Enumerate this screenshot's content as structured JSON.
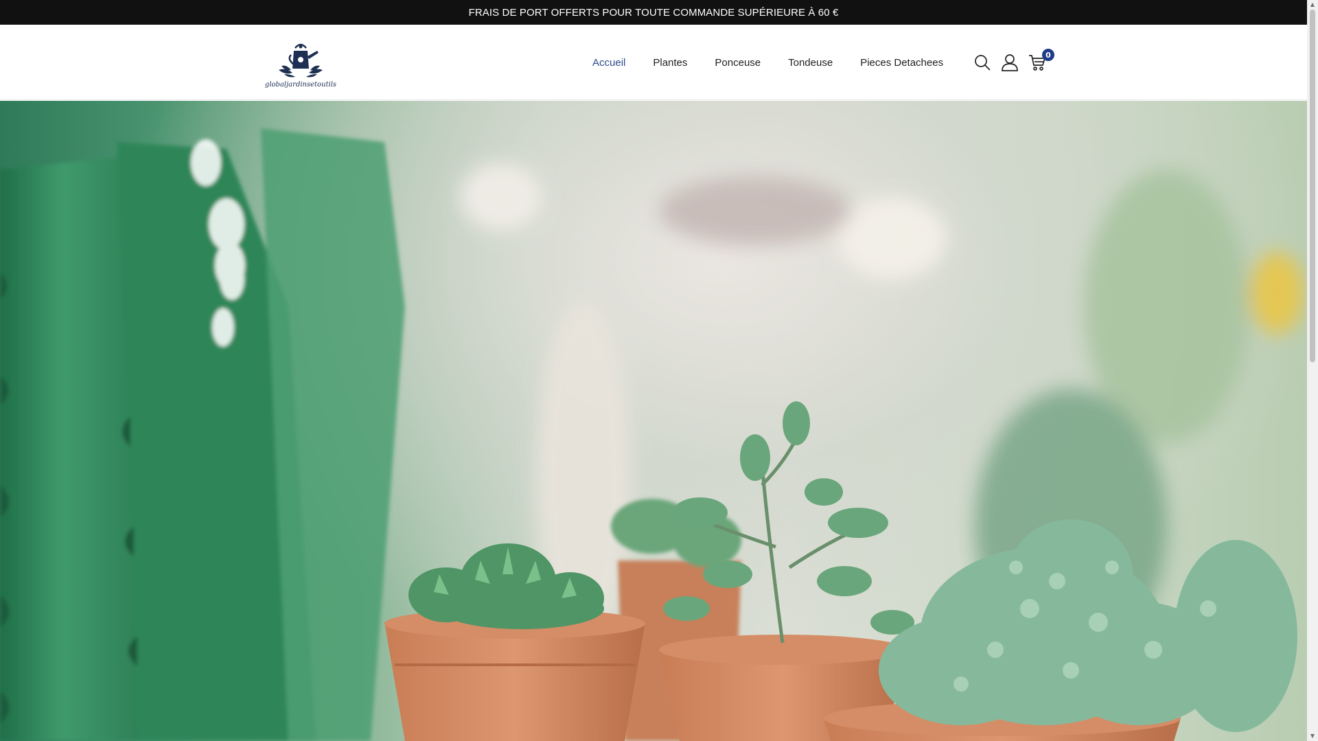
{
  "announcement": {
    "text": "FRAIS DE PORT OFFERTS POUR TOUTE COMMANDE SUPÉRIEURE À 60 €"
  },
  "header": {
    "logo_text": "globaljardinsetoutils",
    "nav": [
      {
        "label": "Accueil",
        "active": true
      },
      {
        "label": "Plantes",
        "active": false
      },
      {
        "label": "Ponceuse",
        "active": false
      },
      {
        "label": "Tondeuse",
        "active": false
      },
      {
        "label": "Pieces Detachees",
        "active": false
      }
    ],
    "icons": {
      "search": "search-icon",
      "account": "user-icon",
      "cart": "cart-icon"
    },
    "cart_count": "0"
  },
  "colors": {
    "announcement_bg": "#111111",
    "nav_active": "#2f4a8f",
    "badge": "#1f3c88"
  },
  "hero": {
    "image": "potted-succulents-and-cactus"
  }
}
